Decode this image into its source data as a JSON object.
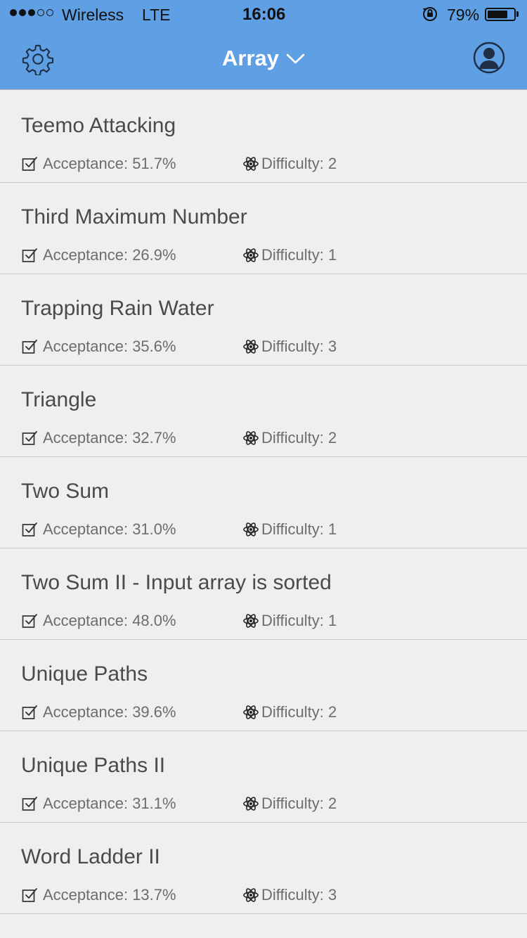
{
  "status_bar": {
    "carrier": "Wireless",
    "network": "LTE",
    "time": "16:06",
    "battery_percent_text": "79%",
    "battery_level": 0.79,
    "signal_strength": 3,
    "signal_total": 5,
    "icons": [
      "signal-dots-icon",
      "orientation-lock-icon",
      "battery-icon"
    ]
  },
  "header": {
    "title": "Array",
    "left_icon": "gear-icon",
    "title_icon": "chevron-down-icon",
    "right_icon": "user-icon",
    "background_color": "#5f9fe4",
    "text_color": "#ffffff"
  },
  "list": {
    "acceptance_label": "Acceptance: ",
    "difficulty_label": "Difficulty: ",
    "acceptance_icon": "checked-box-icon",
    "difficulty_icon": "atom-icon",
    "items": [
      {
        "title": "Teemo Attacking",
        "acceptance": "51.7%",
        "difficulty": "2"
      },
      {
        "title": "Third Maximum Number",
        "acceptance": "26.9%",
        "difficulty": "1"
      },
      {
        "title": "Trapping Rain Water",
        "acceptance": "35.6%",
        "difficulty": "3"
      },
      {
        "title": "Triangle",
        "acceptance": "32.7%",
        "difficulty": "2"
      },
      {
        "title": "Two Sum",
        "acceptance": "31.0%",
        "difficulty": "1"
      },
      {
        "title": "Two Sum II - Input array is sorted",
        "acceptance": "48.0%",
        "difficulty": "1"
      },
      {
        "title": "Unique Paths",
        "acceptance": "39.6%",
        "difficulty": "2"
      },
      {
        "title": "Unique Paths II",
        "acceptance": "31.1%",
        "difficulty": "2"
      },
      {
        "title": "Word Ladder II",
        "acceptance": "13.7%",
        "difficulty": "3"
      }
    ]
  }
}
